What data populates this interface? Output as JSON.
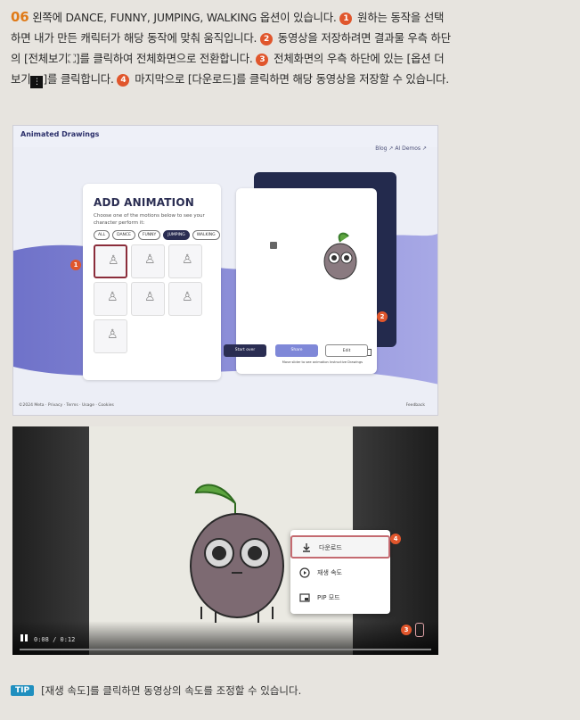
{
  "paragraph": {
    "step_num": "06",
    "line1_a": " 왼쪽에 DANCE, FUNNY, JUMPING, WALKING 옵션이 있습니다. ",
    "mark1": "1",
    "line1_b": " 원하는 동작을 선택",
    "line2_a": "하면 내가 만든 캐릭터가 해당 동작에 맞춰 움직입니다. ",
    "mark2": "2",
    "line2_b": " 동영상을 저장하려면 결과물 우측 하단",
    "line3_a": "의 [전체보기",
    "fullscreen_glyph": "⛶",
    "line3_b": "]를 클릭하여 전체화면으로 전환합니다. ",
    "mark3": "3",
    "line3_c": " 전체화면의 우측 하단에 있는 [옵션 더",
    "line4_a": "보기",
    "more_glyph": "⋮",
    "line4_b": "]를 클릭합니다. ",
    "mark4": "4",
    "line4_c": " 마지막으로 [다운로드]를 클릭하면 해당 동영상을 저장할 수 있습니다."
  },
  "screenshot1": {
    "logo": "Animated Drawings",
    "nav": "Blog ↗  AI Demos ↗",
    "card_title": "ADD ANIMATION",
    "card_sub": "Choose one of the motions below to see your character perform it:",
    "filters": [
      {
        "label": "ALL",
        "active": false
      },
      {
        "label": "DANCE",
        "active": false
      },
      {
        "label": "FUNNY",
        "active": false
      },
      {
        "label": "JUMPING",
        "active": true
      },
      {
        "label": "WALKING",
        "active": false
      }
    ],
    "tile_glyph": "♙",
    "badge1": "1",
    "badge2": "2",
    "preview_caption": "Move slider to see animation Instructive Drawings",
    "btn_start": "Start over",
    "btn_share": "Share",
    "btn_next": "Edit",
    "footer": "©2024 Meta · Privacy · Terms · Usage · Cookies",
    "footer_right": "Feedback"
  },
  "screenshot2": {
    "time": "0:08 / 0:12",
    "menu": [
      {
        "label": "다운로드",
        "icon": "download-icon"
      },
      {
        "label": "재생 속도",
        "icon": "playback-speed-icon"
      },
      {
        "label": "PIP 모드",
        "icon": "pip-icon"
      }
    ],
    "badge3": "3",
    "badge4": "4"
  },
  "tip": {
    "badge": "TIP",
    "text": "[재생 속도]를 클릭하면 동영상의 속도를 조정할 수 있습니다."
  },
  "colors": {
    "accent_orange": "#e0562c",
    "step_orange": "#e07a18",
    "tip_blue": "#1f8fbf",
    "purple": "#7f7fd1",
    "navy": "#232a4d"
  }
}
